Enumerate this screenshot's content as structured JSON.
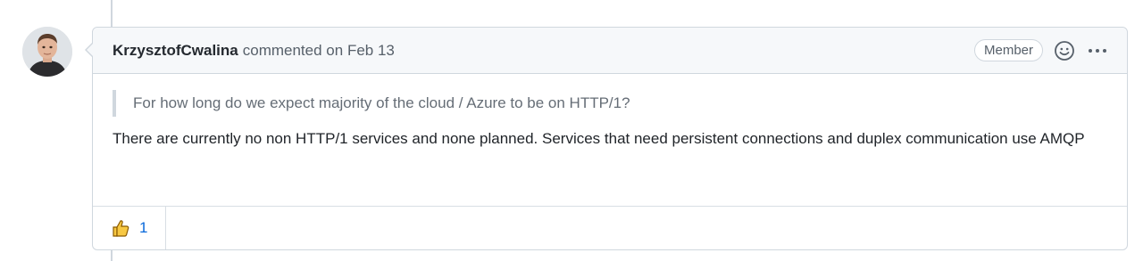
{
  "comment": {
    "author": "KrzysztofCwalina",
    "action": "commented on",
    "date": "Feb 13",
    "role_badge": "Member",
    "quote": "For how long do we expect majority of the cloud / Azure to be on HTTP/1?",
    "body": "There are currently no non HTTP/1 services and none planned. Services that need persistent connections and duplex communication use AMQP"
  },
  "reactions": [
    {
      "icon": "thumbs-up-icon",
      "count": "1"
    }
  ],
  "colors": {
    "header_bg": "#f6f8fa",
    "border": "#d0d7de",
    "link_blue": "#0969da",
    "muted_text": "#57606a"
  }
}
